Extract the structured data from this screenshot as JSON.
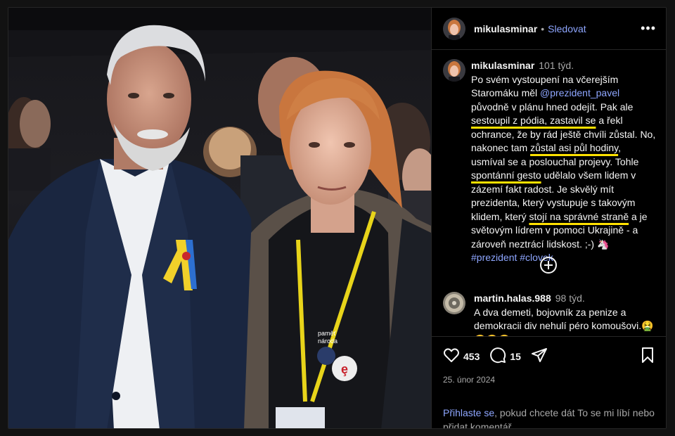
{
  "post": {
    "username": "mikulasminar",
    "follow_label": "Sledovat",
    "more_label": "•••"
  },
  "caption": {
    "username": "mikulasminar",
    "time": "101 týd.",
    "p1": "Po svém vystoupení na včerejším Staromáku měl ",
    "mention": "@prezident_pavel",
    "p2": " původně v plánu hned odejít. Pak ale ",
    "u1": "sestoupil z pódia, zastavil se",
    "p3": " a řekl ochrance, že by rád ještě chvíli zůstal. No, nakonec tam ",
    "u2": "zůstal asi půl hodiny",
    "p4": ", usmíval se a poslouchal projevy. Tohle ",
    "u3": "spontánní gesto",
    "p5": " udělalo všem lidem v zázemí fakt radost. Je skvělý mít prezidenta, který vystupuje s takovým klidem, který ",
    "u4": "stojí na správné straně",
    "p6": " a je světovým lídrem v pomoci Ukrajině - a zároveň neztrácí lidskost. ;-) 🦄 ",
    "tags": "#prezident #clovek"
  },
  "comment": {
    "username": "martin.halas.988",
    "time": "98 týd.",
    "text": "A dva demeti, bojovník za penize a demokracii div nehulí péro komoušovi.🤮 😂😂😂"
  },
  "actions": {
    "likes": "453",
    "comments": "15",
    "date": "25. únor 2024"
  },
  "login": {
    "link": "Přihlaste se",
    "rest": ", pokud chcete dát To se mi líbí nebo přidat komentář."
  },
  "photo": {
    "lanyard_text": "paměť národa"
  },
  "colors": {
    "accent": "#8ea6ff",
    "underline": "#ffe100"
  }
}
